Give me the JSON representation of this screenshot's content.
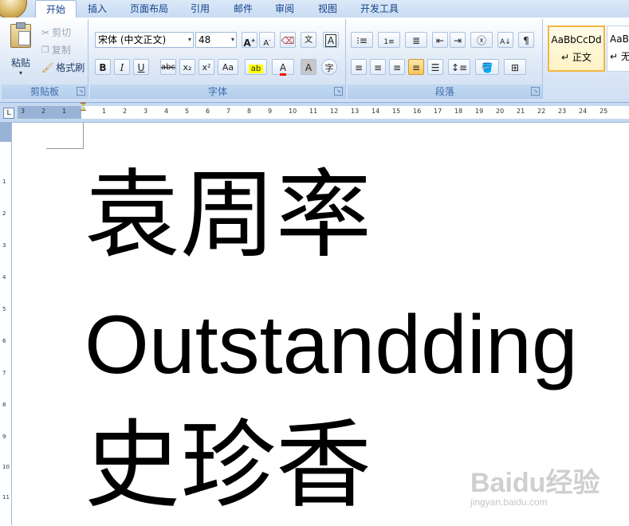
{
  "tabs": [
    "开始",
    "插入",
    "页面布局",
    "引用",
    "邮件",
    "审阅",
    "视图",
    "开发工具"
  ],
  "clipboard": {
    "paste_label": "粘贴",
    "cut_label": "剪切",
    "copy_label": "复制",
    "format_painter_label": "格式刷",
    "group_label": "剪贴板"
  },
  "font": {
    "font_name": "宋体 (中文正文)",
    "font_size": "48",
    "bold": "B",
    "italic": "I",
    "underline": "U",
    "strike": "abc",
    "subscript": "x₂",
    "superscript": "x²",
    "change_case": "Aa",
    "group_label": "字体"
  },
  "paragraph": {
    "group_label": "段落"
  },
  "styles": {
    "normal_sample": "AaBbCcDd",
    "normal_label": "正文",
    "next_sample": "AaB",
    "next_label": "无"
  },
  "document": {
    "line1": "袁周率",
    "line2": "Outstandding",
    "line3": "史珍香"
  },
  "watermark": {
    "logo": "Baidu经验",
    "sub": "jingyan.baidu.com"
  },
  "ruler": {
    "left_ticks": [
      "3",
      "2",
      "1"
    ],
    "ticks": [
      "1",
      "2",
      "3",
      "4",
      "5",
      "6",
      "7",
      "8",
      "9",
      "10",
      "11",
      "12",
      "13",
      "14",
      "15",
      "16",
      "17",
      "18",
      "19",
      "20",
      "21",
      "22",
      "23",
      "24",
      "25"
    ],
    "vticks": [
      "1",
      "2",
      "3",
      "4",
      "5",
      "6",
      "7",
      "8",
      "9",
      "10",
      "11"
    ]
  },
  "colors": {
    "highlight": "#ffff00",
    "font_color": "#ff0000",
    "accent": "#15428b"
  }
}
